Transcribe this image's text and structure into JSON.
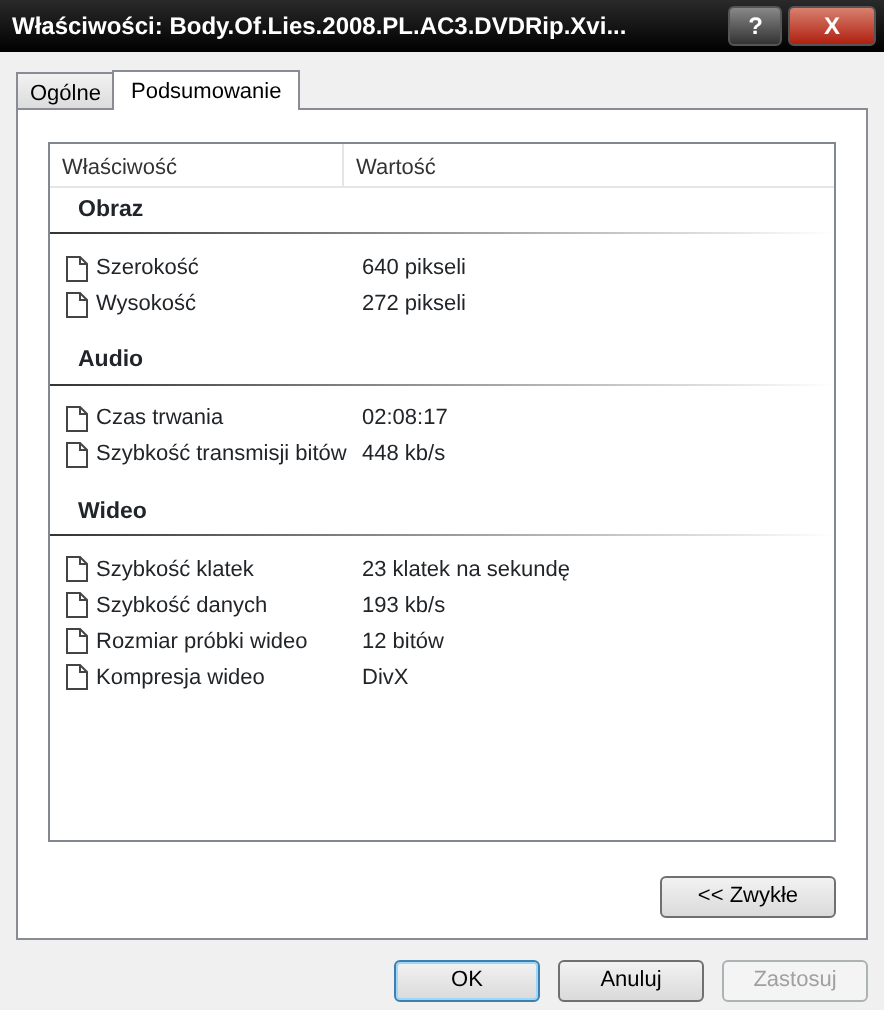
{
  "window": {
    "title": "Właściwości: Body.Of.Lies.2008.PL.AC3.DVDRip.Xvi...",
    "controls": [
      {
        "kind": "help",
        "label": "?"
      },
      {
        "kind": "close",
        "label": "X"
      }
    ]
  },
  "tabs": [
    {
      "label": "Ogólne",
      "selected": false
    },
    {
      "label": "Podsumowanie",
      "selected": true
    }
  ],
  "table": {
    "columns": [
      "Właściwość",
      "Wartość"
    ],
    "groups": [
      {
        "title": "Obraz",
        "rows": [
          {
            "property": "Szerokość",
            "value": "640 pikseli"
          },
          {
            "property": "Wysokość",
            "value": "272 pikseli"
          }
        ]
      },
      {
        "title": "Audio",
        "rows": [
          {
            "property": "Czas trwania",
            "value": "02:08:17"
          },
          {
            "property": "Szybkość transmisji bitów",
            "value": "448 kb/s"
          }
        ]
      },
      {
        "title": "Wideo",
        "rows": [
          {
            "property": "Szybkość klatek",
            "value": "23 klatek na sekundę"
          },
          {
            "property": "Szybkość danych",
            "value": "193 kb/s"
          },
          {
            "property": "Rozmiar próbki wideo",
            "value": "12 bitów"
          },
          {
            "property": "Kompresja wideo",
            "value": "DivX"
          }
        ]
      }
    ]
  },
  "toggle_button": {
    "label": "<< Zwykłe"
  },
  "buttons": [
    {
      "label": "OK",
      "default": true,
      "disabled": false
    },
    {
      "label": "Anuluj",
      "default": false,
      "disabled": false
    },
    {
      "label": "Zastosuj",
      "default": false,
      "disabled": true
    }
  ]
}
